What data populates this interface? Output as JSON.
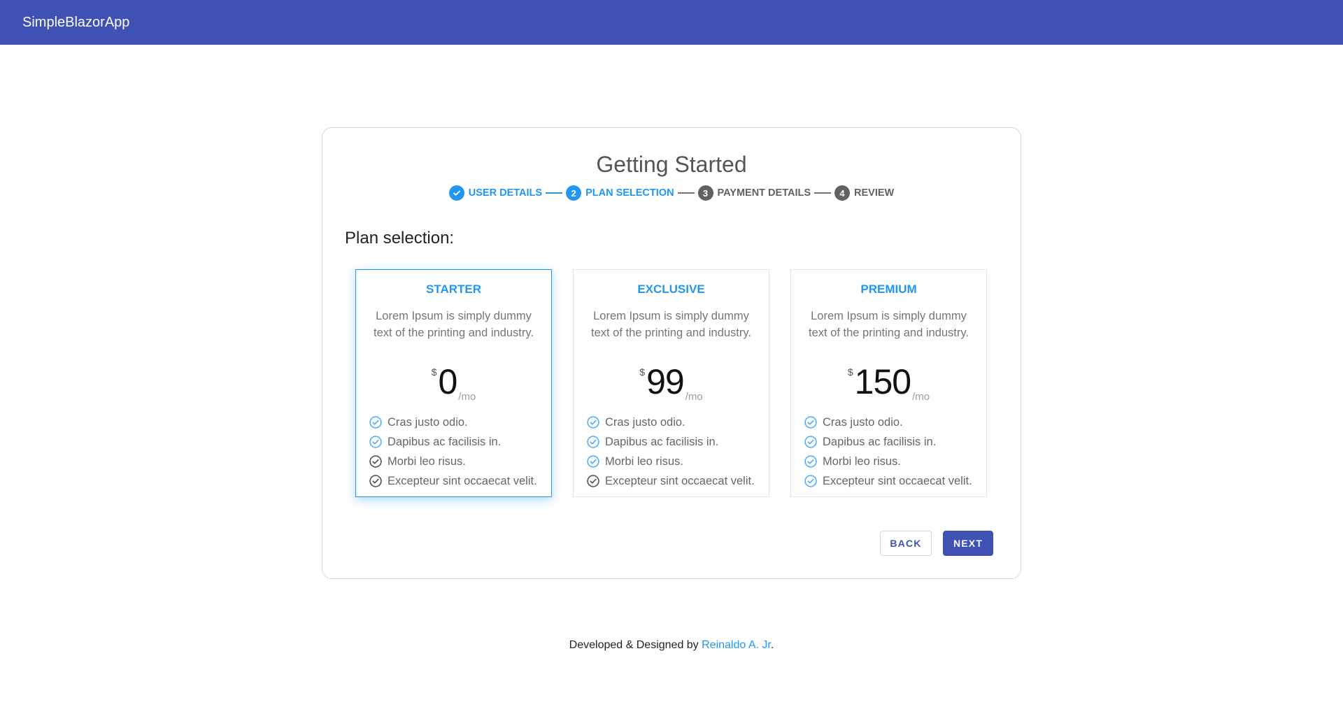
{
  "app": {
    "title": "SimpleBlazorApp"
  },
  "wizard": {
    "title": "Getting Started",
    "steps": [
      {
        "number": "",
        "label": "USER DETAILS",
        "state": "done"
      },
      {
        "number": "2",
        "label": "PLAN SELECTION",
        "state": "active"
      },
      {
        "number": "3",
        "label": "PAYMENT DETAILS",
        "state": "todo"
      },
      {
        "number": "4",
        "label": "REVIEW",
        "state": "todo"
      }
    ],
    "section_title": "Plan selection:",
    "plans": [
      {
        "name": "STARTER",
        "description": "Lorem Ipsum is simply dummy text of the printing and industry.",
        "currency": "$",
        "price": "0",
        "period": "/mo",
        "selected": true,
        "features": [
          {
            "text": "Cras justo odio.",
            "included": true
          },
          {
            "text": "Dapibus ac facilisis in.",
            "included": true
          },
          {
            "text": "Morbi leo risus.",
            "included": false
          },
          {
            "text": "Excepteur sint occaecat velit.",
            "included": false
          }
        ]
      },
      {
        "name": "EXCLUSIVE",
        "description": "Lorem Ipsum is simply dummy text of the printing and industry.",
        "currency": "$",
        "price": "99",
        "period": "/mo",
        "selected": false,
        "features": [
          {
            "text": "Cras justo odio.",
            "included": true
          },
          {
            "text": "Dapibus ac facilisis in.",
            "included": true
          },
          {
            "text": "Morbi leo risus.",
            "included": true
          },
          {
            "text": "Excepteur sint occaecat velit.",
            "included": false
          }
        ]
      },
      {
        "name": "PREMIUM",
        "description": "Lorem Ipsum is simply dummy text of the printing and industry.",
        "currency": "$",
        "price": "150",
        "period": "/mo",
        "selected": false,
        "features": [
          {
            "text": "Cras justo odio.",
            "included": true
          },
          {
            "text": "Dapibus ac facilisis in.",
            "included": true
          },
          {
            "text": "Morbi leo risus.",
            "included": true
          },
          {
            "text": "Excepteur sint occaecat velit.",
            "included": true
          }
        ]
      }
    ],
    "back_label": "BACK",
    "next_label": "NEXT"
  },
  "footer": {
    "prefix": "Developed & Designed by ",
    "link_text": "Reinaldo A. Jr",
    "suffix": "."
  },
  "colors": {
    "primary": "#3f51b5",
    "accent": "#2196f3",
    "inactive": "#616161",
    "feature_off": "#555555"
  },
  "icons": {
    "step_done": "check-circle-icon",
    "feature_included": "check-circle-outline-icon"
  }
}
